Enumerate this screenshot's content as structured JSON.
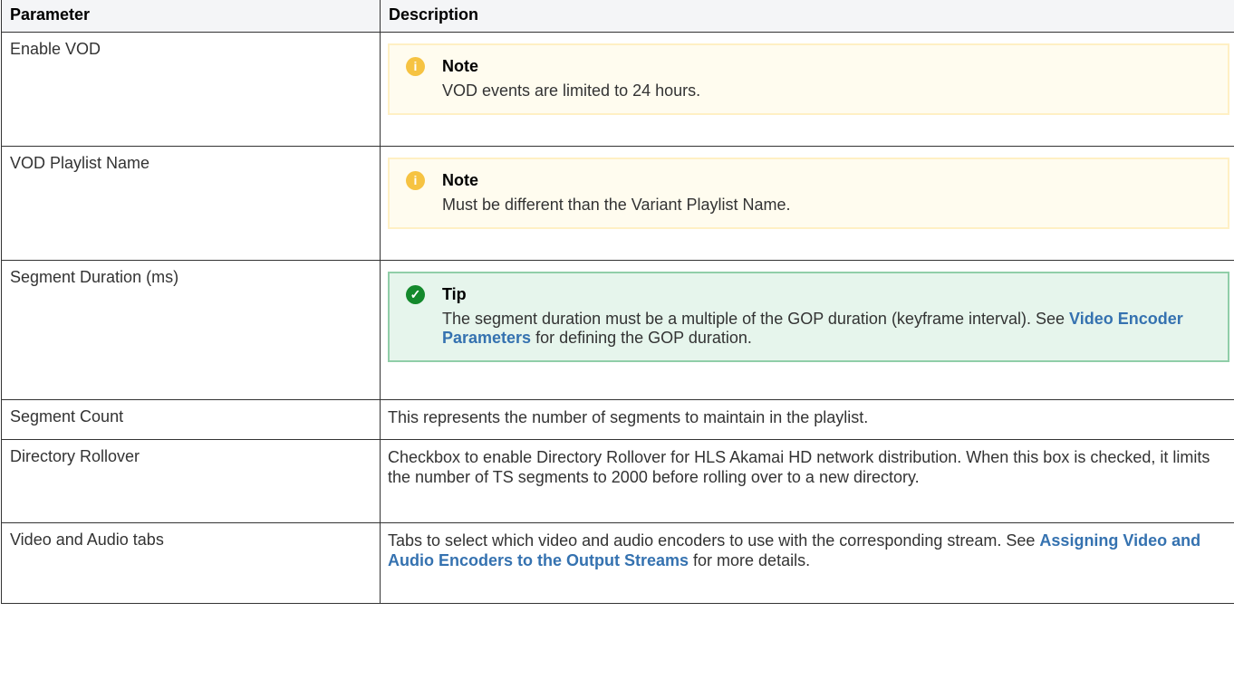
{
  "headers": {
    "parameter": "Parameter",
    "description": "Description"
  },
  "rows": {
    "enable_vod": {
      "param": "Enable VOD",
      "panel_title": "Note",
      "panel_text": "VOD events are limited to 24 hours."
    },
    "vod_playlist_name": {
      "param": "VOD Playlist Name",
      "panel_title": "Note",
      "panel_text": "Must be different than the Variant Playlist Name."
    },
    "segment_duration": {
      "param": "Segment Duration (ms)",
      "panel_title": "Tip",
      "text_before": "The segment duration must be a multiple of the GOP duration (keyframe interval). See ",
      "link": "Video Encoder Parameters",
      "text_after": " for defining the GOP duration."
    },
    "segment_count": {
      "param": "Segment Count",
      "desc": "This represents the number of segments to maintain in the playlist."
    },
    "directory_rollover": {
      "param": "Directory Rollover",
      "desc": "Checkbox to enable Directory Rollover for HLS Akamai HD network distribution. When this box is checked, it limits the number of TS segments to 2000 before rolling over to a new directory."
    },
    "video_audio_tabs": {
      "param": "Video and Audio tabs",
      "text_before": "Tabs to select which video and audio encoders to use with the corresponding stream. See ",
      "link": "Assigning Video and Audio Encoders to the Output Streams",
      "text_after": " for more details."
    }
  },
  "icons": {
    "note": "info-icon",
    "tip": "check-circle-icon"
  },
  "colors": {
    "note_bg": "#fffcef",
    "note_border": "#fff0c4",
    "note_icon": "#f6c342",
    "tip_bg": "#e6f5ec",
    "tip_border": "#90cea8",
    "tip_icon": "#14892c",
    "link": "#3572b0"
  }
}
